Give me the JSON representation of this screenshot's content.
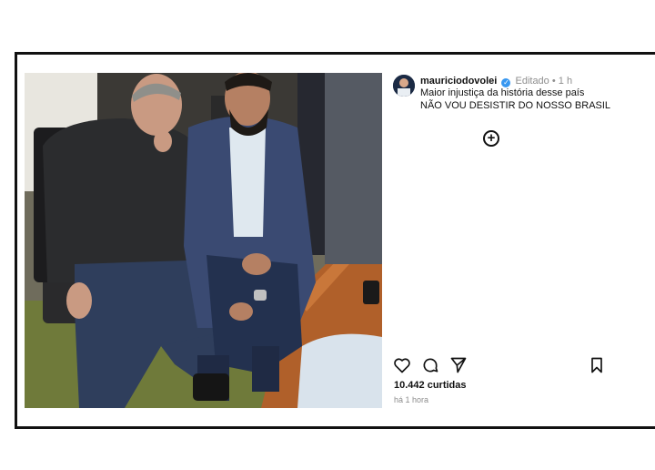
{
  "post": {
    "username": "mauriciodovolei",
    "verified_mark": "✓",
    "edited_label": "Editado",
    "separator": "•",
    "age": "1 h",
    "caption_line1": "Maior injustiça da história desse país",
    "caption_line2": "NÃO VOU DESISTIR DO NOSSO BRASIL",
    "add_symbol": "+",
    "likes_text": "10.442 curtidas",
    "timestamp": "há 1 hora"
  },
  "icons": [
    "heart-icon",
    "comment-icon",
    "share-icon",
    "bookmark-icon",
    "verified-icon",
    "add-icon"
  ],
  "colors": {
    "verified_blue": "#3897f0",
    "muted_text": "#8e8e8e",
    "frame_border": "#111111"
  }
}
